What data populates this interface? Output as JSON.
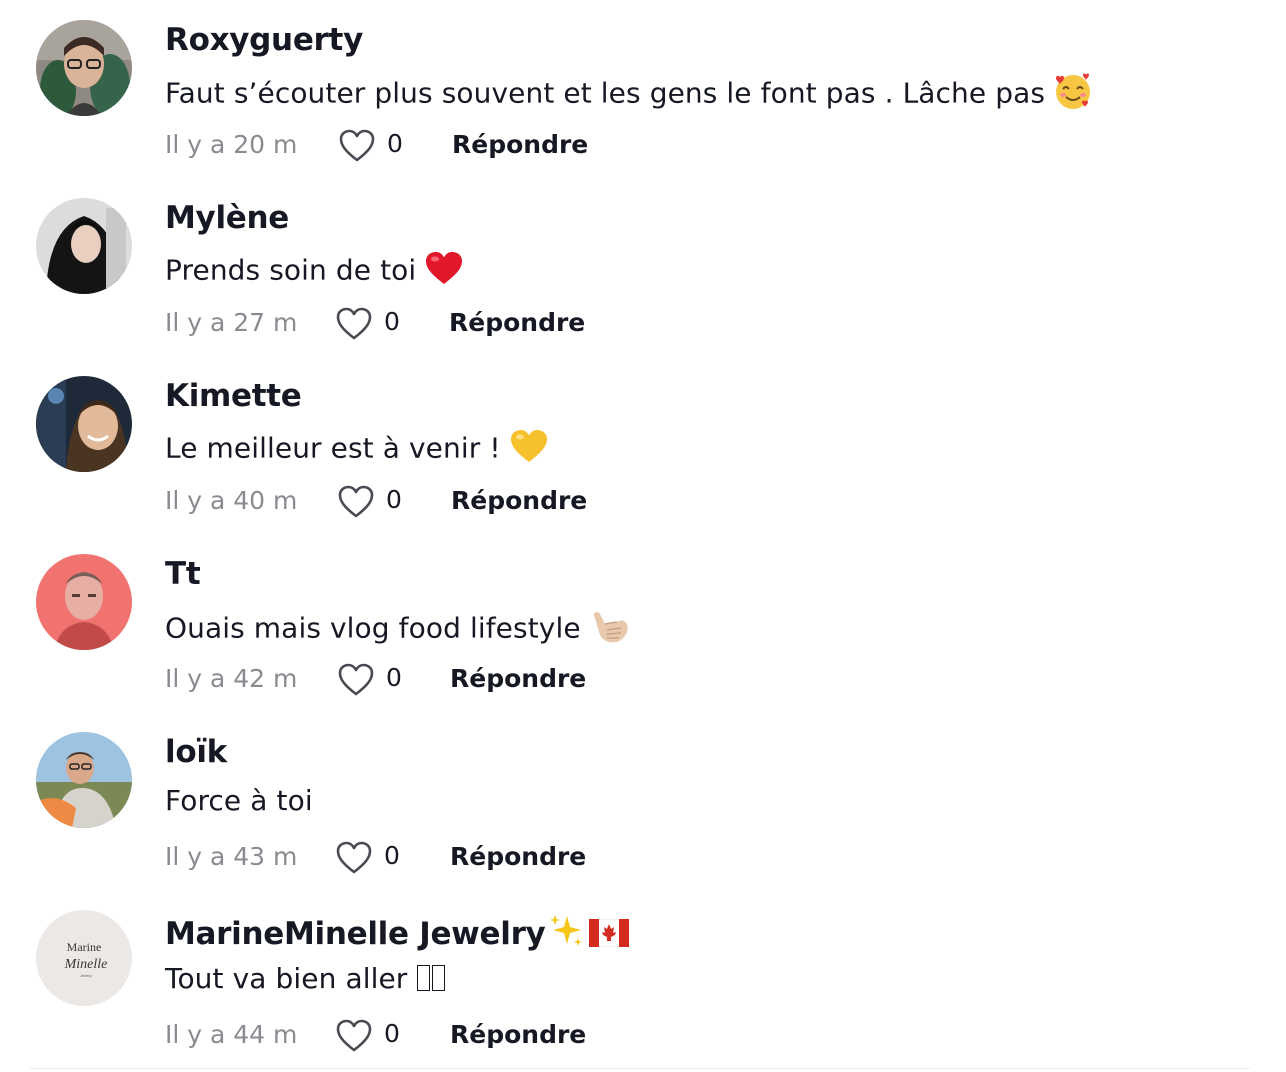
{
  "comments": [
    {
      "author": "Roxyguerty",
      "text": "Faut s’écouter plus souvent et les gens le font pas . Lâche pas",
      "emoji": "smiling-face-with-hearts",
      "time": "Il y a 20 m",
      "likes": "0",
      "reply": "Répondre"
    },
    {
      "author": "Mylène",
      "text": "Prends soin de toi",
      "emoji": "red-heart",
      "time": "Il y a 27 m",
      "likes": "0",
      "reply": "Répondre"
    },
    {
      "author": "Kimette",
      "text": "Le meilleur est à venir !",
      "emoji": "yellow-heart",
      "time": "Il y a 40 m",
      "likes": "0",
      "reply": "Répondre"
    },
    {
      "author": "Tt",
      "text": "Ouais mais vlog food lifestyle",
      "emoji": "call-me-hand",
      "time": "Il y a 42 m",
      "likes": "0",
      "reply": "Répondre"
    },
    {
      "author": "loïk",
      "text": "Force à toi",
      "emoji": "",
      "time": "Il y a 43 m",
      "likes": "0",
      "reply": "Répondre"
    },
    {
      "author": "MarineMinelle Jewelry",
      "author_emoji": [
        "sparkles",
        "flag-canada"
      ],
      "text": "Tout va bien aller",
      "emoji": "missing-glyph",
      "time": "Il y a 44 m",
      "likes": "0",
      "reply": "Répondre",
      "avatar_logo": {
        "line1": "Marine",
        "line2": "Minelle",
        "line3": "Jewelry"
      }
    }
  ],
  "icons": {
    "like": "heart-outline-icon"
  },
  "colors": {
    "text": "#161823",
    "muted": "#8a8b91"
  }
}
